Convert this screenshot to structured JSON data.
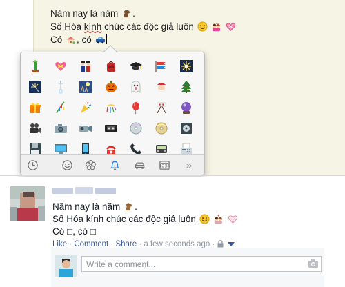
{
  "composer": {
    "line1": "Năm nay là năm",
    "line1_end": ".",
    "line2_prefix": "Số Hóa ",
    "line2_misspelled": "kính",
    "line2_rest": " chúc các độc giả luôn",
    "line3_prefix": "Có",
    "line3_mid": ", có"
  },
  "picker": {
    "rows": [
      [
        "bamboo-icon",
        "heart-ribbon-icon",
        "dolls-icon",
        "school-bag-icon",
        "graduation-cap-icon",
        "carp-streamer-icon",
        "fireworks-icon"
      ],
      [
        "sparkler-icon",
        "wind-chime-icon",
        "moon-viewing-icon",
        "jack-o-lantern-icon",
        "ghost-icon",
        "santa-icon",
        "christmas-tree-icon"
      ],
      [
        "gift-icon",
        "tanabata-tree-icon",
        "party-popper-icon",
        "confetti-ball-icon",
        "balloon-icon",
        "crossed-flags-icon",
        "crystal-ball-icon"
      ],
      [
        "movie-camera-icon",
        "camera-icon",
        "video-camera-icon",
        "vhs-icon",
        "cd-icon",
        "dvd-icon",
        "minidisc-icon"
      ],
      [
        "floppy-icon",
        "computer-icon",
        "phone-icon",
        "telephone-icon",
        "receiver-icon",
        "pager-icon",
        "fax-icon"
      ]
    ],
    "categories": [
      "recent-clock-icon",
      "smiley-icon",
      "flower-icon",
      "bell-icon",
      "car-icon",
      "symbols-icon",
      "more-chevrons-icon"
    ],
    "active_category": "bell-icon",
    "more_label": "»"
  },
  "post": {
    "line1": "Năm nay là năm",
    "line1_end": ".",
    "line2": "Số Hóa kính chúc các độc giả luôn",
    "line3_prefix": "Có",
    "line3_mid": ", có",
    "missing_glyph": "□",
    "actions": {
      "like": "Like",
      "dot1": " · ",
      "comment": "Comment",
      "dot2": " · ",
      "share": "Share",
      "dot3": " · ",
      "time": "a few seconds ago",
      "dot4": " · "
    },
    "comment_placeholder": "Write a comment..."
  },
  "colors": {
    "link": "#3b5998",
    "composer_bg": "#f6f4e4",
    "picker_bg": "#f7f7f7",
    "meta": "#9197a3"
  }
}
